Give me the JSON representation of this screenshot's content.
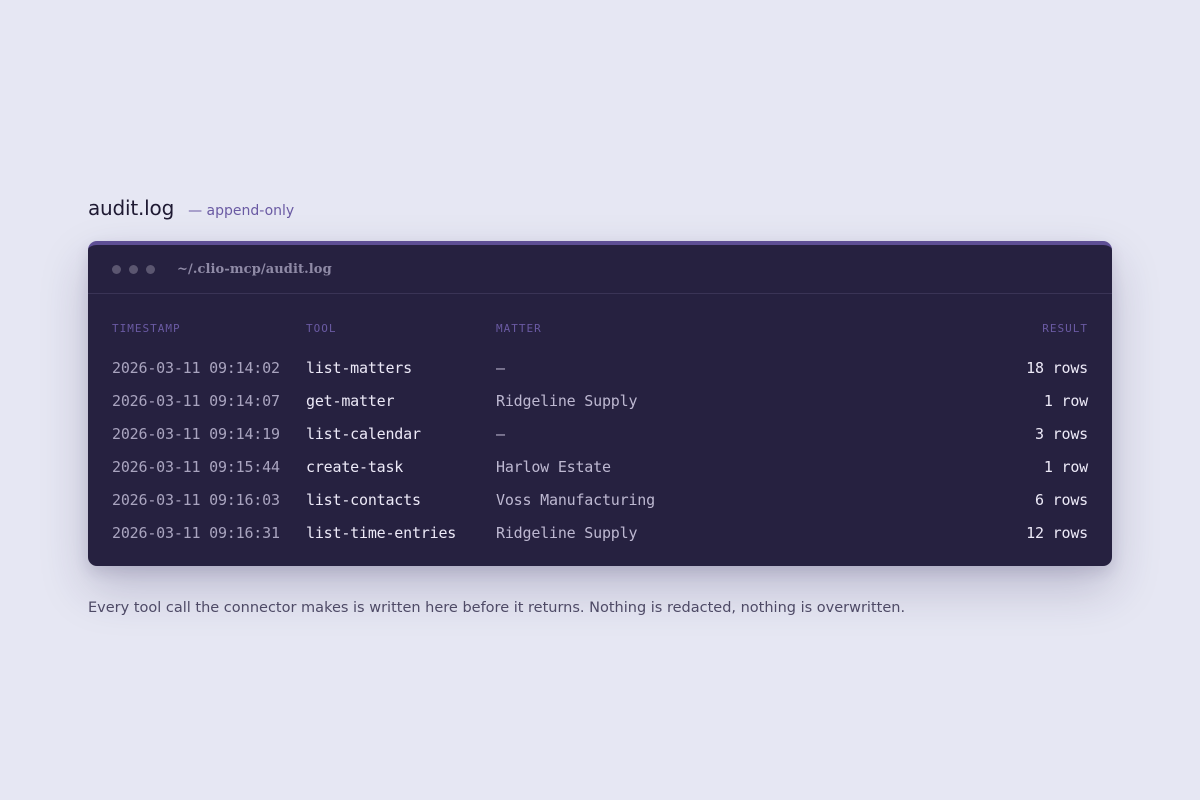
{
  "header": {
    "title": "audit.log",
    "subtitle": "— append-only"
  },
  "terminal": {
    "path": "~/.clio-mcp/audit.log",
    "columns": {
      "timestamp": "TIMESTAMP",
      "tool": "TOOL",
      "matter": "MATTER",
      "result": "RESULT"
    },
    "rows": [
      {
        "timestamp": "2026-03-11 09:14:02",
        "tool": "list-matters",
        "matter": "—",
        "result": "18 rows"
      },
      {
        "timestamp": "2026-03-11 09:14:07",
        "tool": "get-matter",
        "matter": "Ridgeline Supply",
        "result": "1 row"
      },
      {
        "timestamp": "2026-03-11 09:14:19",
        "tool": "list-calendar",
        "matter": "—",
        "result": "3 rows"
      },
      {
        "timestamp": "2026-03-11 09:15:44",
        "tool": "create-task",
        "matter": "Harlow Estate",
        "result": "1 row"
      },
      {
        "timestamp": "2026-03-11 09:16:03",
        "tool": "list-contacts",
        "matter": "Voss Manufacturing",
        "result": "6 rows"
      },
      {
        "timestamp": "2026-03-11 09:16:31",
        "tool": "list-time-entries",
        "matter": "Ridgeline Supply",
        "result": "12 rows"
      }
    ]
  },
  "caption": "Every tool call the connector makes is written here before it returns. Nothing is redacted, nothing is overwritten.",
  "colors": {
    "background": "#e6e7f3",
    "terminal": "#262140",
    "accent": "#5e4f95",
    "header_text": "#6a5aa3"
  }
}
